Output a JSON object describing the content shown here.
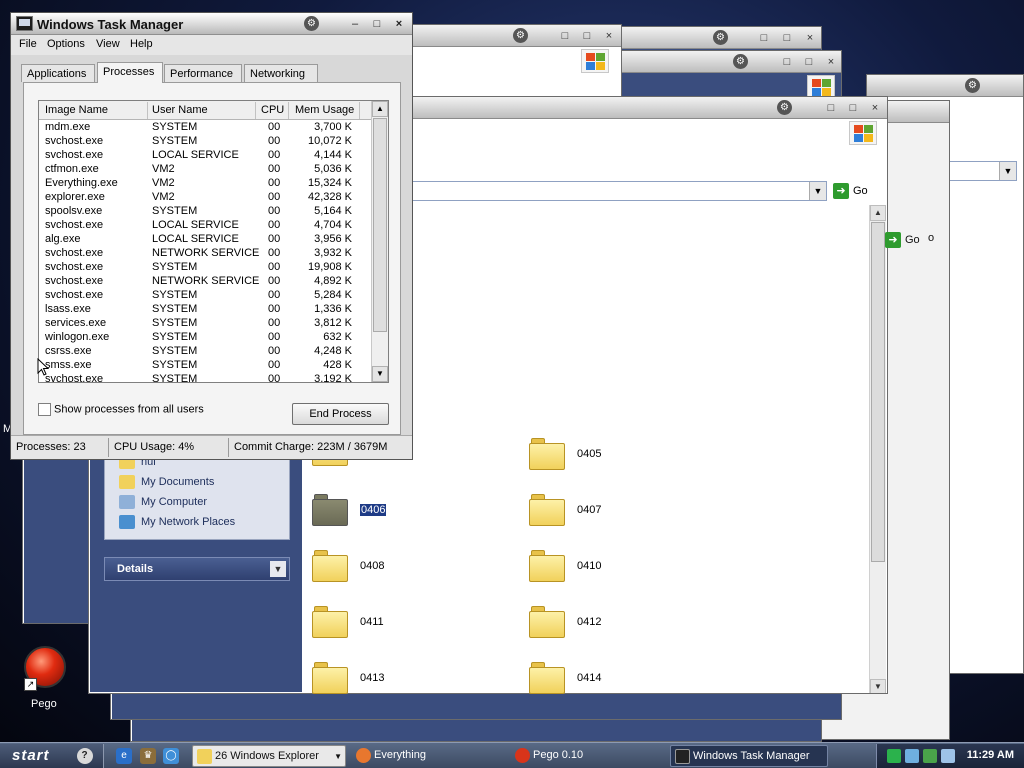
{
  "explorer": {
    "go_label": "Go",
    "partial_go_text": "o",
    "taskpane": {
      "partial_top_item": "nui",
      "items": [
        {
          "label": "My Documents",
          "icon": "my-documents-icon"
        },
        {
          "label": "My Computer",
          "icon": "my-computer-icon"
        },
        {
          "label": "My Network Places",
          "icon": "my-network-places-icon"
        }
      ],
      "details_label": "Details"
    },
    "folders": [
      {
        "name": "0405",
        "selected": false
      },
      {
        "name": "0406",
        "selected": true
      },
      {
        "name": "0407",
        "selected": false
      },
      {
        "name": "0408",
        "selected": false
      },
      {
        "name": "0410",
        "selected": false
      },
      {
        "name": "0411",
        "selected": false
      },
      {
        "name": "0412",
        "selected": false
      },
      {
        "name": "0413",
        "selected": false
      },
      {
        "name": "0414",
        "selected": false
      }
    ]
  },
  "task_manager": {
    "title": "Windows Task Manager",
    "menu": [
      "File",
      "Options",
      "View",
      "Help"
    ],
    "tabs": [
      "Applications",
      "Processes",
      "Performance",
      "Networking"
    ],
    "active_tab": "Processes",
    "columns": [
      "Image Name",
      "User Name",
      "CPU",
      "Mem Usage"
    ],
    "processes": [
      {
        "image": "mdm.exe",
        "user": "SYSTEM",
        "cpu": "00",
        "mem": "3,700 K"
      },
      {
        "image": "svchost.exe",
        "user": "SYSTEM",
        "cpu": "00",
        "mem": "10,072 K"
      },
      {
        "image": "svchost.exe",
        "user": "LOCAL SERVICE",
        "cpu": "00",
        "mem": "4,144 K"
      },
      {
        "image": "ctfmon.exe",
        "user": "VM2",
        "cpu": "00",
        "mem": "5,036 K"
      },
      {
        "image": "Everything.exe",
        "user": "VM2",
        "cpu": "00",
        "mem": "15,324 K"
      },
      {
        "image": "explorer.exe",
        "user": "VM2",
        "cpu": "00",
        "mem": "42,328 K"
      },
      {
        "image": "spoolsv.exe",
        "user": "SYSTEM",
        "cpu": "00",
        "mem": "5,164 K"
      },
      {
        "image": "svchost.exe",
        "user": "LOCAL SERVICE",
        "cpu": "00",
        "mem": "4,704 K"
      },
      {
        "image": "alg.exe",
        "user": "LOCAL SERVICE",
        "cpu": "00",
        "mem": "3,956 K"
      },
      {
        "image": "svchost.exe",
        "user": "NETWORK SERVICE",
        "cpu": "00",
        "mem": "3,932 K"
      },
      {
        "image": "svchost.exe",
        "user": "SYSTEM",
        "cpu": "00",
        "mem": "19,908 K"
      },
      {
        "image": "svchost.exe",
        "user": "NETWORK SERVICE",
        "cpu": "00",
        "mem": "4,892 K"
      },
      {
        "image": "svchost.exe",
        "user": "SYSTEM",
        "cpu": "00",
        "mem": "5,284 K"
      },
      {
        "image": "lsass.exe",
        "user": "SYSTEM",
        "cpu": "00",
        "mem": "1,336 K"
      },
      {
        "image": "services.exe",
        "user": "SYSTEM",
        "cpu": "00",
        "mem": "3,812 K"
      },
      {
        "image": "winlogon.exe",
        "user": "SYSTEM",
        "cpu": "00",
        "mem": "632 K"
      },
      {
        "image": "csrss.exe",
        "user": "SYSTEM",
        "cpu": "00",
        "mem": "4,248 K"
      },
      {
        "image": "smss.exe",
        "user": "SYSTEM",
        "cpu": "00",
        "mem": "428 K"
      },
      {
        "image": "svchost.exe",
        "user": "SYSTEM",
        "cpu": "00",
        "mem": "3,192 K"
      }
    ],
    "show_all_label": "Show processes from all users",
    "end_process_label": "End Process",
    "status": {
      "processes": "Processes: 23",
      "cpu": "CPU Usage: 4%",
      "commit": "Commit Charge: 223M / 3679M"
    }
  },
  "desktop": {
    "edge_letter": "M",
    "pego_label": "Pego"
  },
  "taskbar": {
    "start_label": "start",
    "buttons": [
      {
        "label": "26 Windows Explorer",
        "icon": "folder-icon",
        "active": true
      },
      {
        "label": "Everything",
        "icon": "search-icon",
        "active": false
      },
      {
        "label": "Pego 0.10",
        "icon": "pego-icon",
        "active": false
      },
      {
        "label": "Windows Task Manager",
        "icon": "task-manager-icon",
        "active": false
      }
    ],
    "clock": "11:29 AM"
  },
  "colors": {
    "folder_yellow": "#f1d15b",
    "selection_blue": "#1e3b86",
    "taskpane_blue": "#3a4d7e",
    "go_green": "#2e9b2e"
  }
}
